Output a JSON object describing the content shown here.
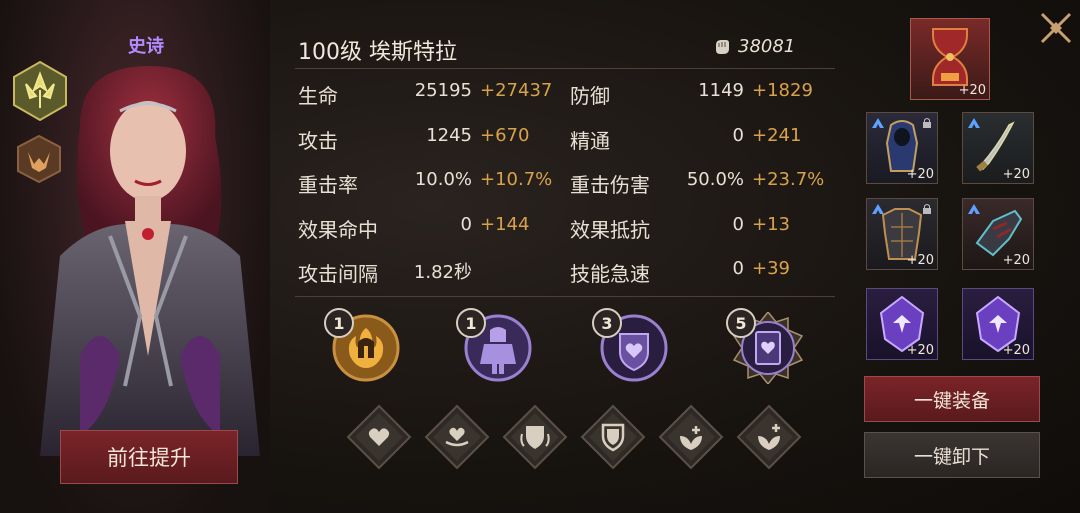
{
  "hero": {
    "rarity": "史诗",
    "title": "100级 埃斯特拉",
    "power": "38081",
    "upgrade_label": "前往提升"
  },
  "stats": [
    {
      "name": "生命",
      "base": "25195",
      "bonus": "+27437"
    },
    {
      "name": "防御",
      "base": "1149",
      "bonus": "+1829"
    },
    {
      "name": "攻击",
      "base": "1245",
      "bonus": "+670"
    },
    {
      "name": "精通",
      "base": "0",
      "bonus": "+241"
    },
    {
      "name": "重击率",
      "base": "10.0%",
      "bonus": "+10.7%"
    },
    {
      "name": "重击伤害",
      "base": "50.0%",
      "bonus": "+23.7%"
    },
    {
      "name": "效果命中",
      "base": "0",
      "bonus": "+144"
    },
    {
      "name": "效果抵抗",
      "base": "0",
      "bonus": "+13"
    },
    {
      "name": "攻击间隔",
      "base": "1.82秒",
      "bonus": ""
    },
    {
      "name": "技能急速",
      "base": "0",
      "bonus": "+39"
    }
  ],
  "skills": [
    {
      "level": "1",
      "icon": "spartan-helmet-fire-icon"
    },
    {
      "level": "1",
      "icon": "armored-knight-icon"
    },
    {
      "level": "3",
      "icon": "heart-shield-icon"
    },
    {
      "level": "5",
      "icon": "heart-card-icon"
    }
  ],
  "traits": [
    {
      "icon": "heart-icon"
    },
    {
      "icon": "heart-hand-icon"
    },
    {
      "icon": "shield-icon"
    },
    {
      "icon": "shield-outline-icon"
    },
    {
      "icon": "leaf-plus-icon"
    },
    {
      "icon": "leaf-plus-alt-icon"
    }
  ],
  "equipment": [
    {
      "slot": "artifact",
      "level": "+20",
      "icon": "hourglass-relic-icon",
      "upgrade": false,
      "locked": false
    },
    {
      "slot": "armor",
      "level": "+20",
      "icon": "hooded-armor-icon",
      "upgrade": true,
      "locked": true
    },
    {
      "slot": "weapon",
      "level": "+20",
      "icon": "curved-dagger-icon",
      "upgrade": true,
      "locked": false
    },
    {
      "slot": "chest",
      "level": "+20",
      "icon": "plate-chest-icon",
      "upgrade": true,
      "locked": true
    },
    {
      "slot": "gloves",
      "level": "+20",
      "icon": "gauntlet-icon",
      "upgrade": true,
      "locked": false
    },
    {
      "slot": "gem1",
      "level": "+20",
      "icon": "purple-crystal-icon",
      "upgrade": false,
      "locked": false
    },
    {
      "slot": "gem2",
      "level": "+20",
      "icon": "purple-crystal-icon",
      "upgrade": false,
      "locked": false
    }
  ],
  "buttons": {
    "equip_all": "一键装备",
    "unequip_all": "一键卸下"
  },
  "colors": {
    "bonus": "#d9a24a",
    "rarity": "#b28cff",
    "primary_button": "#6a1f22"
  }
}
